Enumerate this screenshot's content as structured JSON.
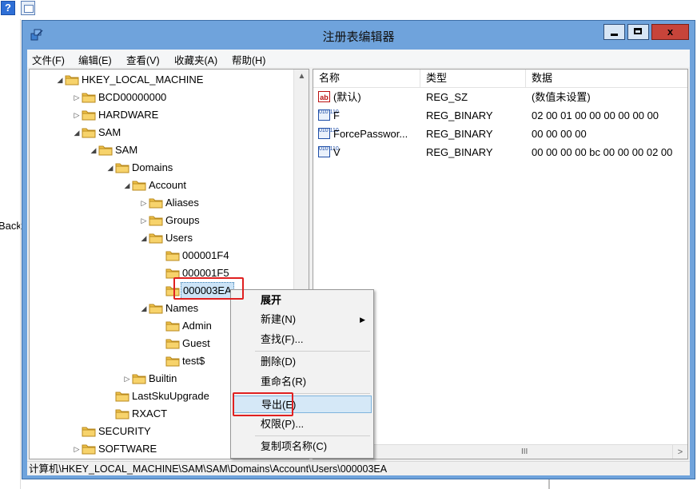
{
  "toolbar": {
    "help_icon": "help-icon",
    "view_icon": "view-icon",
    "help_glyph": "?"
  },
  "background": {
    "left_text": "Back"
  },
  "window": {
    "title": "注册表编辑器",
    "close_glyph": "x",
    "menu": [
      "文件(F)",
      "编辑(E)",
      "查看(V)",
      "收藏夹(A)",
      "帮助(H)"
    ]
  },
  "tree": {
    "nodes": [
      {
        "label": "HKEY_LOCAL_MACHINE",
        "expander": "◢"
      },
      {
        "label": "BCD00000000",
        "expander": "▷"
      },
      {
        "label": "HARDWARE",
        "expander": "▷"
      },
      {
        "label": "SAM",
        "expander": "◢"
      },
      {
        "label": "SAM",
        "expander": "◢"
      },
      {
        "label": "Domains",
        "expander": "◢"
      },
      {
        "label": "Account",
        "expander": "◢"
      },
      {
        "label": "Aliases",
        "expander": "▷"
      },
      {
        "label": "Groups",
        "expander": "▷"
      },
      {
        "label": "Users",
        "expander": "◢"
      },
      {
        "label": "000001F4",
        "expander": ""
      },
      {
        "label": "000001F5",
        "expander": ""
      },
      {
        "label": "000003EA",
        "expander": "",
        "selected": true
      },
      {
        "label": "Names",
        "expander": "◢"
      },
      {
        "label": "Admin",
        "expander": ""
      },
      {
        "label": "Guest",
        "expander": ""
      },
      {
        "label": "test$",
        "expander": ""
      },
      {
        "label": "Builtin",
        "expander": "▷"
      },
      {
        "label": "LastSkuUpgrade",
        "expander": ""
      },
      {
        "label": "RXACT",
        "expander": ""
      },
      {
        "label": "SECURITY",
        "expander": ""
      },
      {
        "label": "SOFTWARE",
        "expander": "▷"
      }
    ],
    "scroll_up": "▲",
    "scroll_grip": "≡"
  },
  "list": {
    "columns": [
      "名称",
      "类型",
      "数据"
    ],
    "rows": [
      {
        "icon": "ab",
        "name": "(默认)",
        "type": "REG_SZ",
        "data": "(数值未设置)"
      },
      {
        "icon": "bin",
        "name": "F",
        "type": "REG_BINARY",
        "data": "02 00 01 00 00 00 00 00 00"
      },
      {
        "icon": "bin",
        "name": "ForcePasswor...",
        "type": "REG_BINARY",
        "data": "00 00 00 00"
      },
      {
        "icon": "bin",
        "name": "V",
        "type": "REG_BINARY",
        "data": "00 00 00 00 bc 00 00 00 02 00"
      }
    ],
    "hscroll_grip": "III",
    "hscroll_right": ">"
  },
  "status": {
    "path": "计算机\\HKEY_LOCAL_MACHINE\\SAM\\SAM\\Domains\\Account\\Users\\000003EA"
  },
  "context_menu": {
    "items": [
      {
        "label": "展开",
        "bold": true
      },
      {
        "label": "新建(N)",
        "submenu": "▶"
      },
      {
        "label": "查找(F)..."
      },
      {
        "label": "删除(D)"
      },
      {
        "label": "重命名(R)"
      },
      {
        "label": "导出(E)",
        "highlighted": true
      },
      {
        "label": "权限(P)..."
      },
      {
        "label": "复制项名称(C)"
      }
    ]
  },
  "colors": {
    "highlight_red": "#e02020",
    "title_bar": "#6fa3dc",
    "selection": "#cce4f7"
  }
}
